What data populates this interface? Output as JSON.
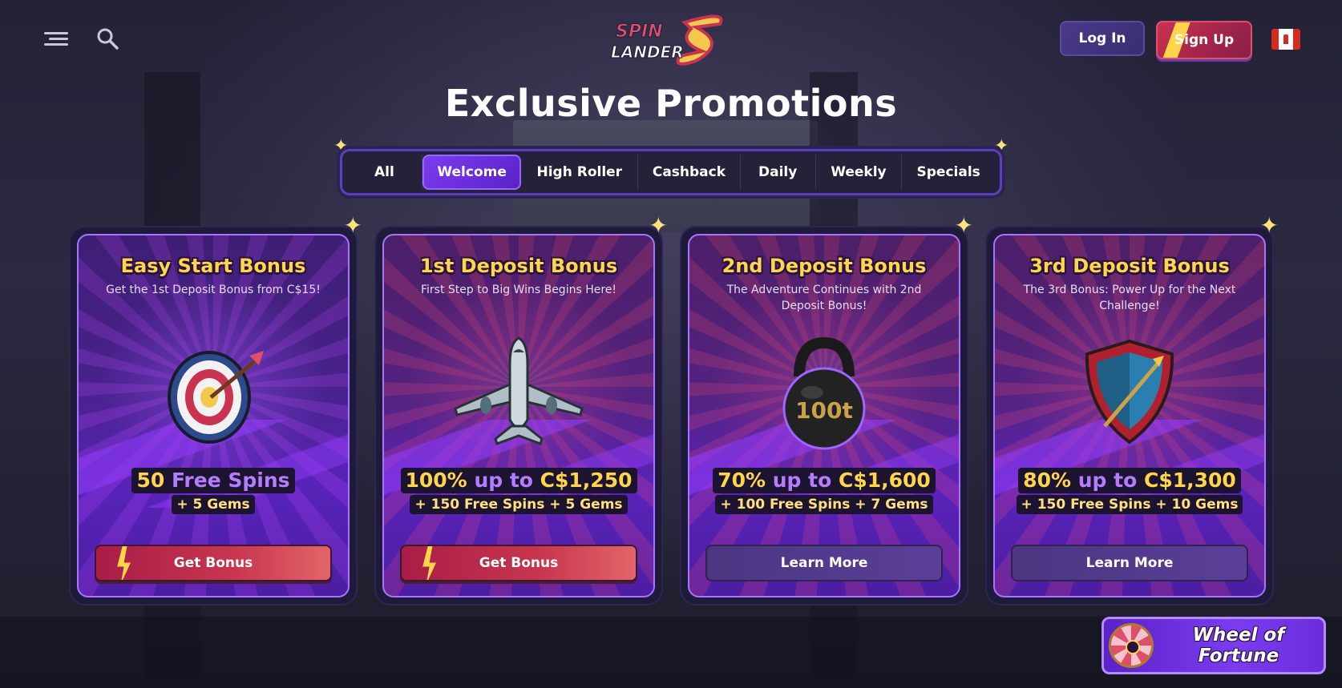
{
  "header": {
    "logo_text_top": "SPIN",
    "logo_text_bottom": "LANDER",
    "login_label": "Log In",
    "signup_label": "Sign Up",
    "flag": "Canada"
  },
  "page_title": "Exclusive Promotions",
  "tabs": [
    {
      "label": "All",
      "active": false
    },
    {
      "label": "Welcome",
      "active": true
    },
    {
      "label": "High Roller",
      "active": false
    },
    {
      "label": "Cashback",
      "active": false
    },
    {
      "label": "Daily",
      "active": false
    },
    {
      "label": "Weekly",
      "active": false
    },
    {
      "label": "Specials",
      "active": false
    }
  ],
  "cards": [
    {
      "title": "Easy Start Bonus",
      "subtitle": "Get the 1st Deposit Bonus from C$15!",
      "art": "target-icon",
      "offer_a": "50 ",
      "offer_b": "Free Spins",
      "offer_c": "",
      "offer_extra": "+ 5 Gems",
      "button": "Get Bonus"
    },
    {
      "title": "1st Deposit Bonus",
      "subtitle": "First Step to Big Wins Begins Here!",
      "art": "airplane-icon",
      "offer_a": "100% ",
      "offer_b": "up to ",
      "offer_c": "C$1,250",
      "offer_extra": "+ 150 Free Spins + 5 Gems",
      "button": "Get Bonus"
    },
    {
      "title": "2nd Deposit Bonus",
      "subtitle": "The Adventure Continues with 2nd Deposit Bonus!",
      "art": "kettlebell-icon",
      "art_text": "100t",
      "offer_a": "70% ",
      "offer_b": "up to ",
      "offer_c": "C$1,600",
      "offer_extra": "+ 100 Free Spins + 7 Gems",
      "button": "Learn More"
    },
    {
      "title": "3rd Deposit Bonus",
      "subtitle": "The 3rd Bonus: Power Up for the Next Challenge!",
      "art": "shield-icon",
      "offer_a": "80% ",
      "offer_b": "up to ",
      "offer_c": "C$1,300",
      "offer_extra": "+ 150 Free Spins + 10 Gems",
      "button": "Learn More"
    }
  ],
  "wheel_of_fortune": {
    "label": "Wheel of Fortune"
  },
  "colors": {
    "accent_purple": "#7b3cf0",
    "title_gold": "#ffd54a",
    "signup_red": "#c9334f"
  }
}
